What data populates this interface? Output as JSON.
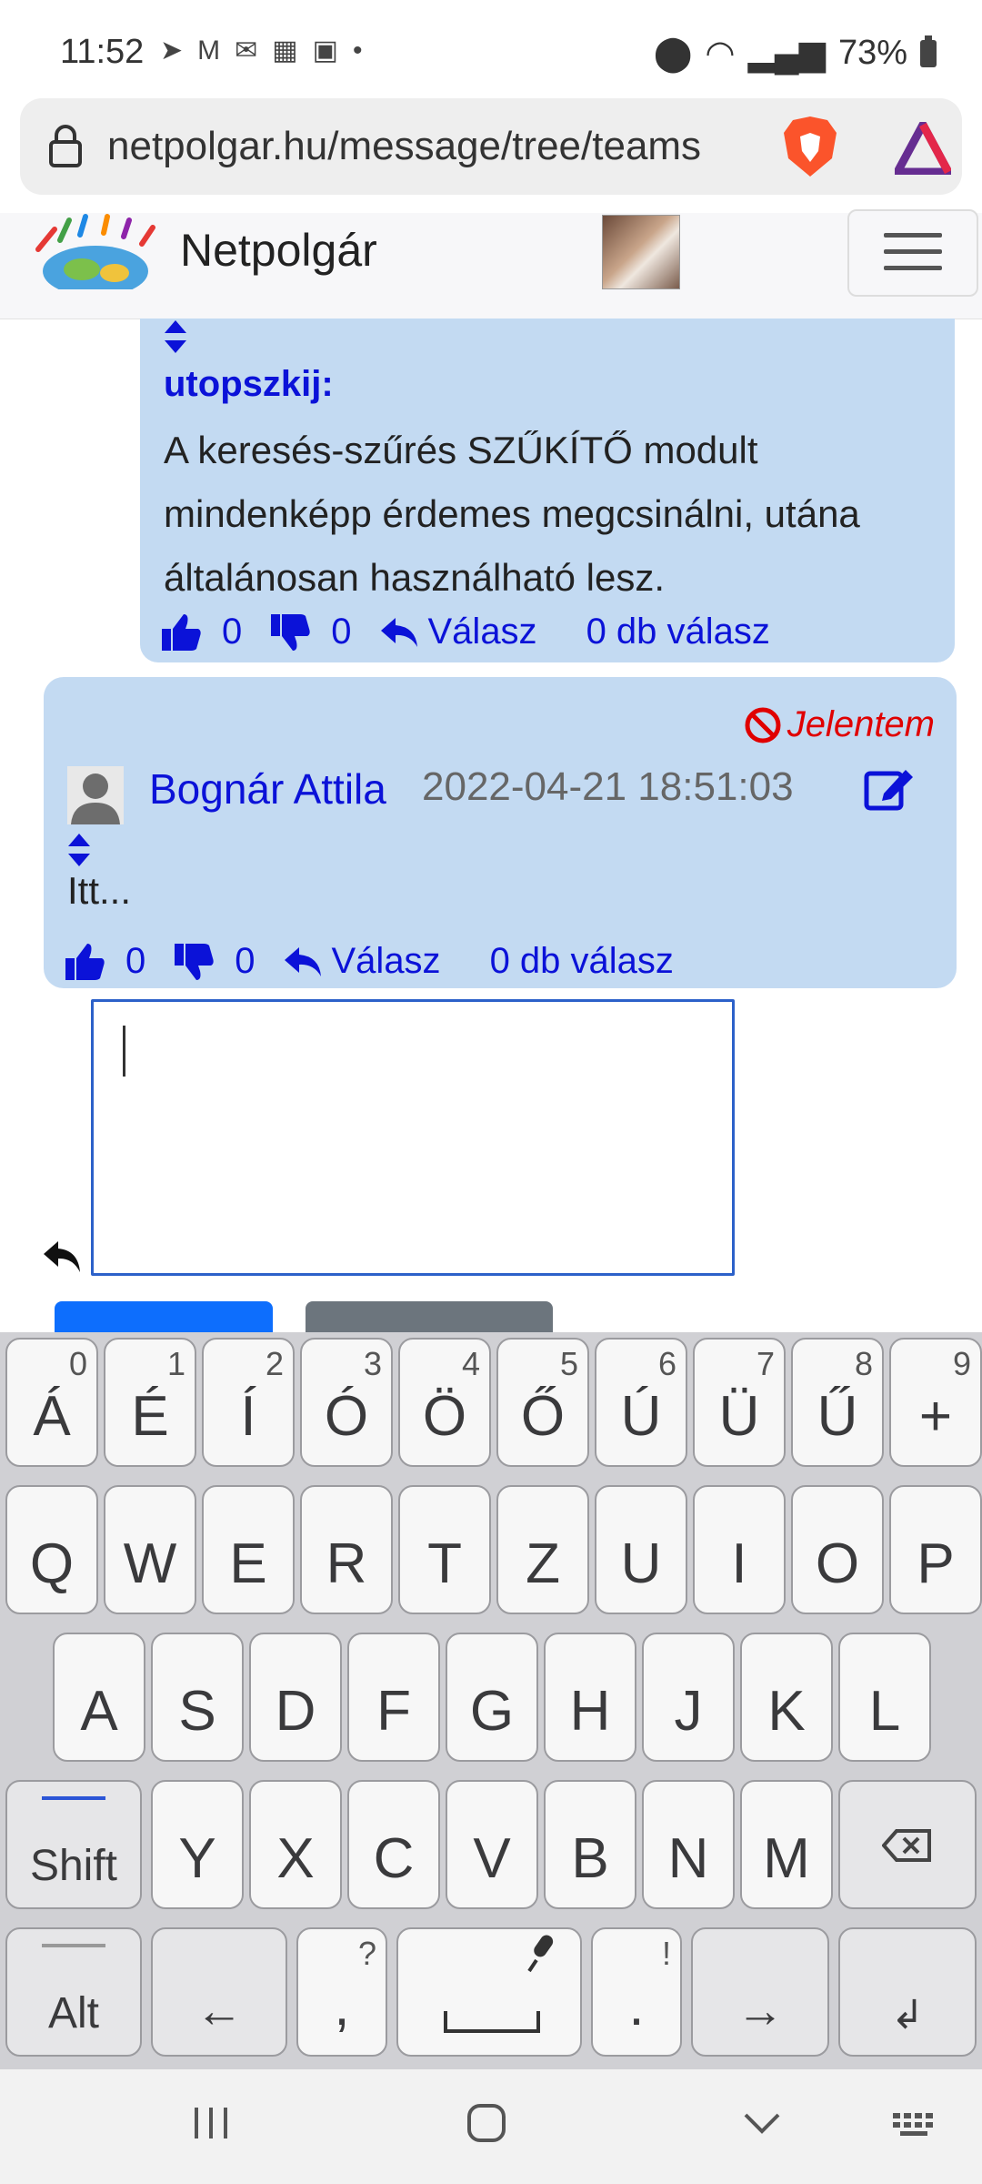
{
  "status": {
    "time": "11:52",
    "battery": "73%",
    "notif_icons": [
      "navigation-icon",
      "gmail-icon",
      "outlook-icon",
      "voicemail-icon",
      "gallery-icon",
      "dot-icon"
    ]
  },
  "browser": {
    "url": "netpolgar.hu/message/tree/teams"
  },
  "site": {
    "brand": "Netpolgár"
  },
  "messages": [
    {
      "author": "utopszkij:",
      "text_lines": [
        "A keresés-szűrés SZŰKÍTŐ modult",
        "mindenképp érdemes megcsinálni, utána",
        "általánosan használható lesz."
      ],
      "likes": "0",
      "dislikes": "0",
      "reply_label": "Válasz",
      "replies_label": "0 db válasz"
    },
    {
      "report_label": "Jelentem",
      "author": "Bognár Attila",
      "date": "2022-04-21 18:51:03",
      "text": "Itt...",
      "likes": "0",
      "dislikes": "0",
      "reply_label": "Válasz",
      "replies_label": "0 db válasz"
    }
  ],
  "keyboard": {
    "row0": [
      {
        "k": "Á",
        "s": "0"
      },
      {
        "k": "É",
        "s": "1"
      },
      {
        "k": "Í",
        "s": "2"
      },
      {
        "k": "Ó",
        "s": "3"
      },
      {
        "k": "Ö",
        "s": "4"
      },
      {
        "k": "Ő",
        "s": "5"
      },
      {
        "k": "Ú",
        "s": "6"
      },
      {
        "k": "Ü",
        "s": "7"
      },
      {
        "k": "Ű",
        "s": "8"
      },
      {
        "k": "+",
        "s": "9"
      }
    ],
    "row1": [
      "Q",
      "W",
      "E",
      "R",
      "T",
      "Z",
      "U",
      "I",
      "O",
      "P"
    ],
    "row2": [
      "A",
      "S",
      "D",
      "F",
      "G",
      "H",
      "J",
      "K",
      "L"
    ],
    "row3": [
      "Y",
      "X",
      "C",
      "V",
      "B",
      "N",
      "M"
    ],
    "shift": "Shift",
    "alt": "Alt",
    "left_arrow": "←",
    "right_arrow": "→",
    "comma": ",",
    "comma_sub": "?",
    "period": ".",
    "period_sub": "!",
    "enter": "↲"
  }
}
